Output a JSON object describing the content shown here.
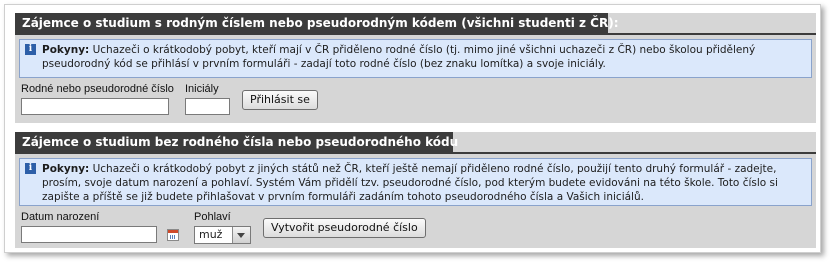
{
  "section1": {
    "title": "Zájemce o studium s rodným číslem nebo pseudorodným kódem (všichni studenti z ČR):",
    "info_label": "Pokyny:",
    "info_text": " Uchazeči o krátkodobý pobyt, kteří mají v ČR přiděleno rodné číslo (tj. mimo jiné všichni uchazeči z ČR) nebo školou přidělený pseudorodný kód se přihlásí v prvním formuláři - zadají toto rodné číslo (bez znaku lomítka) a svoje iniciály.",
    "rc_label": "Rodné nebo pseudorodné číslo",
    "rc_value": "",
    "initials_label": "Iniciály",
    "initials_value": "",
    "login_button": "Přihlásit se"
  },
  "section2": {
    "title": "Zájemce o studium bez rodného čísla nebo pseudorodného kódu",
    "info_label": "Pokyny:",
    "info_text": " Uchazeči o krátkodobý pobyt z jiných států než ČR, kteří ještě nemají přiděleno rodné číslo, použijí tento druhý formulář - zadejte, prosím, svoje datum narození a pohlaví. Systém Vám přidělí tzv. pseudorodné číslo, pod kterým budete evidováni na této škole. Toto číslo si zapište a příště se již budete přihlašovat v prvním formuláři zadáním tohoto pseudorodného čísla a Vašich iniciálů.",
    "birth_label": "Datum narození",
    "birth_value": "",
    "gender_label": "Pohlaví",
    "gender_value": "muž",
    "create_button": "Vytvořit pseudorodné číslo"
  },
  "icons": [
    "info-icon",
    "calendar-icon",
    "dropdown-arrow-icon"
  ],
  "colors": {
    "tab_bg": "#3c3c3c",
    "panel_bg": "#d6d6d6",
    "info_bg": "#dbe8fb",
    "info_border": "#8aa3cc"
  }
}
